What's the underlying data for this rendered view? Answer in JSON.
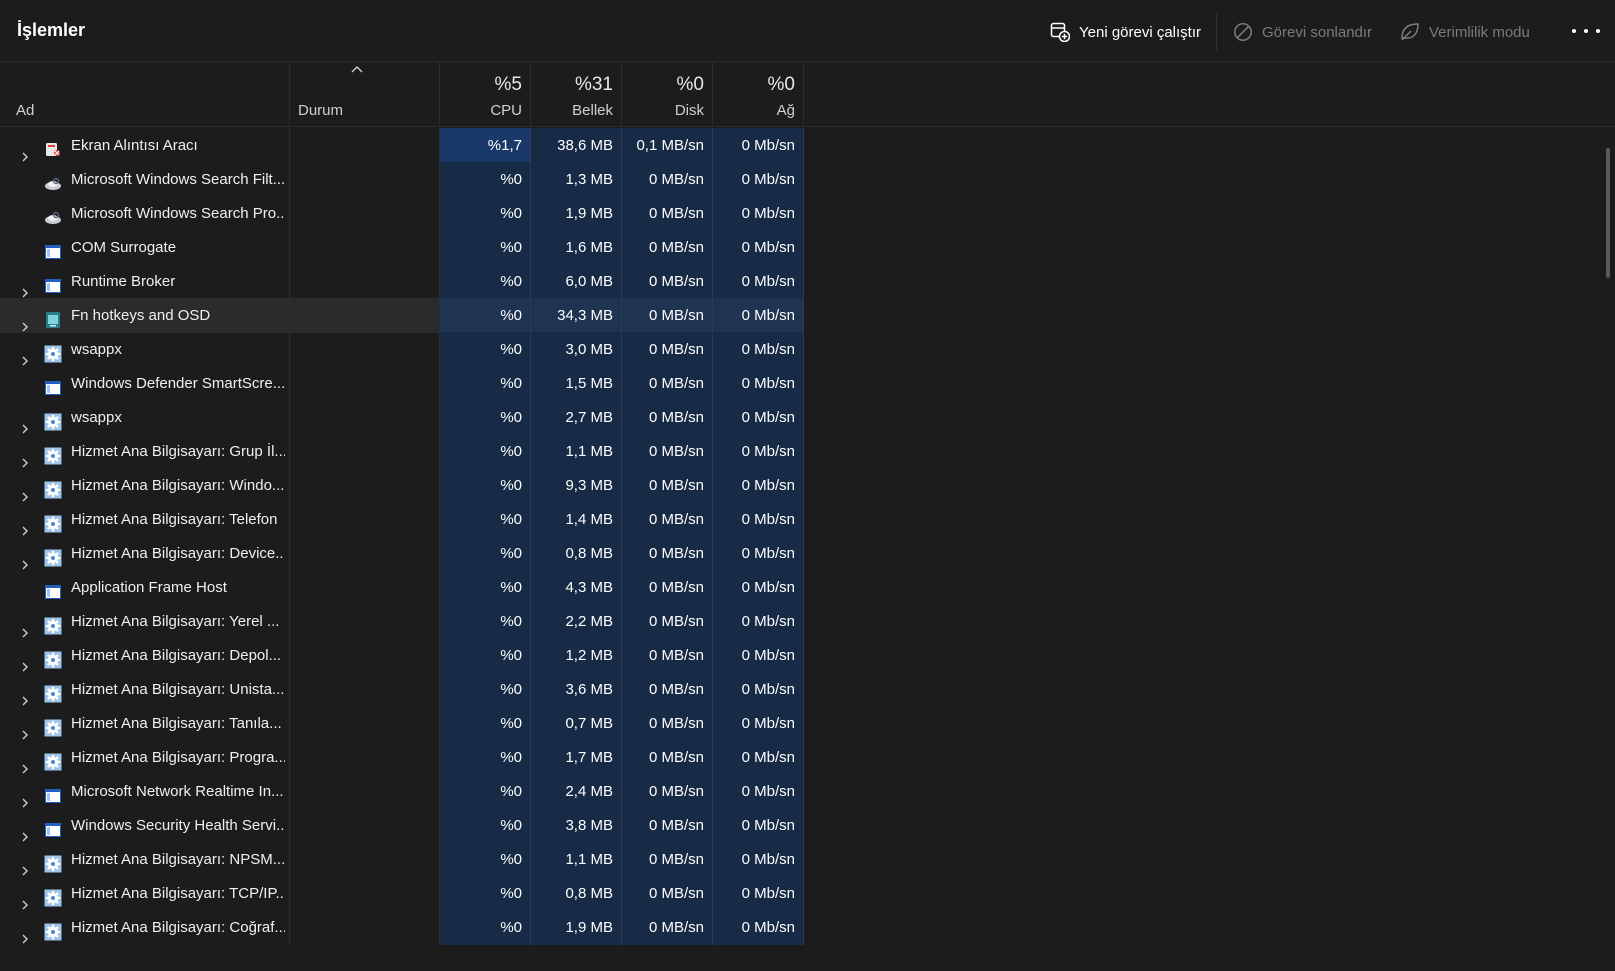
{
  "toolbar": {
    "title": "İşlemler",
    "new_task_label": "Yeni görevi çalıştır",
    "end_task_label": "Görevi sonlandır",
    "efficiency_label": "Verimlilik modu"
  },
  "columns": {
    "name": "Ad",
    "status": "Durum",
    "cpu": {
      "pct": "%5",
      "label": "CPU"
    },
    "memory": {
      "pct": "%31",
      "label": "Bellek"
    },
    "disk": {
      "pct": "%0",
      "label": "Disk"
    },
    "network": {
      "pct": "%0",
      "label": "Ağ"
    }
  },
  "processes": [
    {
      "name": "Ekran Alıntısı Aracı",
      "icon": "snipping-tool-icon",
      "expandable": true,
      "cpu": "%1,7",
      "mem": "38,6 MB",
      "disk": "0,1 MB/sn",
      "net": "0 Mb/sn"
    },
    {
      "name": "Microsoft Windows Search Filt...",
      "icon": "search-service-icon",
      "expandable": false,
      "cpu": "%0",
      "mem": "1,3 MB",
      "disk": "0 MB/sn",
      "net": "0 Mb/sn"
    },
    {
      "name": "Microsoft Windows Search Pro...",
      "icon": "search-service-icon",
      "expandable": false,
      "cpu": "%0",
      "mem": "1,9 MB",
      "disk": "0 MB/sn",
      "net": "0 Mb/sn"
    },
    {
      "name": "COM Surrogate",
      "icon": "window-app-icon",
      "expandable": false,
      "cpu": "%0",
      "mem": "1,6 MB",
      "disk": "0 MB/sn",
      "net": "0 Mb/sn"
    },
    {
      "name": "Runtime Broker",
      "icon": "window-app-icon",
      "expandable": true,
      "cpu": "%0",
      "mem": "6,0 MB",
      "disk": "0 MB/sn",
      "net": "0 Mb/sn"
    },
    {
      "name": "Fn hotkeys and OSD",
      "icon": "hotkeys-app-icon",
      "expandable": true,
      "cpu": "%0",
      "mem": "34,3 MB",
      "disk": "0 MB/sn",
      "net": "0 Mb/sn",
      "highlighted": true
    },
    {
      "name": "wsappx",
      "icon": "service-gear-icon",
      "expandable": true,
      "cpu": "%0",
      "mem": "3,0 MB",
      "disk": "0 MB/sn",
      "net": "0 Mb/sn"
    },
    {
      "name": "Windows Defender SmartScre...",
      "icon": "window-app-icon",
      "expandable": false,
      "cpu": "%0",
      "mem": "1,5 MB",
      "disk": "0 MB/sn",
      "net": "0 Mb/sn"
    },
    {
      "name": "wsappx",
      "icon": "service-gear-icon",
      "expandable": true,
      "cpu": "%0",
      "mem": "2,7 MB",
      "disk": "0 MB/sn",
      "net": "0 Mb/sn"
    },
    {
      "name": "Hizmet Ana Bilgisayarı: Grup İl...",
      "icon": "service-gear-icon",
      "expandable": true,
      "cpu": "%0",
      "mem": "1,1 MB",
      "disk": "0 MB/sn",
      "net": "0 Mb/sn"
    },
    {
      "name": "Hizmet Ana Bilgisayarı: Windo...",
      "icon": "service-gear-icon",
      "expandable": true,
      "cpu": "%0",
      "mem": "9,3 MB",
      "disk": "0 MB/sn",
      "net": "0 Mb/sn"
    },
    {
      "name": "Hizmet Ana Bilgisayarı: Telefon",
      "icon": "service-gear-icon",
      "expandable": true,
      "cpu": "%0",
      "mem": "1,4 MB",
      "disk": "0 MB/sn",
      "net": "0 Mb/sn"
    },
    {
      "name": "Hizmet Ana Bilgisayarı: Device...",
      "icon": "service-gear-icon",
      "expandable": true,
      "cpu": "%0",
      "mem": "0,8 MB",
      "disk": "0 MB/sn",
      "net": "0 Mb/sn"
    },
    {
      "name": "Application Frame Host",
      "icon": "window-app-icon",
      "expandable": false,
      "cpu": "%0",
      "mem": "4,3 MB",
      "disk": "0 MB/sn",
      "net": "0 Mb/sn"
    },
    {
      "name": "Hizmet Ana Bilgisayarı: Yerel ...",
      "icon": "service-gear-icon",
      "expandable": true,
      "cpu": "%0",
      "mem": "2,2 MB",
      "disk": "0 MB/sn",
      "net": "0 Mb/sn"
    },
    {
      "name": "Hizmet Ana Bilgisayarı: Depol...",
      "icon": "service-gear-icon",
      "expandable": true,
      "cpu": "%0",
      "mem": "1,2 MB",
      "disk": "0 MB/sn",
      "net": "0 Mb/sn"
    },
    {
      "name": "Hizmet Ana Bilgisayarı: Unista...",
      "icon": "service-gear-icon",
      "expandable": true,
      "cpu": "%0",
      "mem": "3,6 MB",
      "disk": "0 MB/sn",
      "net": "0 Mb/sn"
    },
    {
      "name": "Hizmet Ana Bilgisayarı: Tanıla...",
      "icon": "service-gear-icon",
      "expandable": true,
      "cpu": "%0",
      "mem": "0,7 MB",
      "disk": "0 MB/sn",
      "net": "0 Mb/sn"
    },
    {
      "name": "Hizmet Ana Bilgisayarı: Progra...",
      "icon": "service-gear-icon",
      "expandable": true,
      "cpu": "%0",
      "mem": "1,7 MB",
      "disk": "0 MB/sn",
      "net": "0 Mb/sn"
    },
    {
      "name": "Microsoft Network Realtime In...",
      "icon": "window-app-icon",
      "expandable": true,
      "cpu": "%0",
      "mem": "2,4 MB",
      "disk": "0 MB/sn",
      "net": "0 Mb/sn"
    },
    {
      "name": "Windows Security Health Servi...",
      "icon": "window-app-icon",
      "expandable": true,
      "cpu": "%0",
      "mem": "3,8 MB",
      "disk": "0 MB/sn",
      "net": "0 Mb/sn"
    },
    {
      "name": "Hizmet Ana Bilgisayarı: NPSM...",
      "icon": "service-gear-icon",
      "expandable": true,
      "cpu": "%0",
      "mem": "1,1 MB",
      "disk": "0 MB/sn",
      "net": "0 Mb/sn"
    },
    {
      "name": "Hizmet Ana Bilgisayarı: TCP/IP...",
      "icon": "service-gear-icon",
      "expandable": true,
      "cpu": "%0",
      "mem": "0,8 MB",
      "disk": "0 MB/sn",
      "net": "0 Mb/sn"
    },
    {
      "name": "Hizmet Ana Bilgisayarı: Coğraf...",
      "icon": "service-gear-icon",
      "expandable": true,
      "cpu": "%0",
      "mem": "1,9 MB",
      "disk": "0 MB/sn",
      "net": "0 Mb/sn"
    }
  ]
}
